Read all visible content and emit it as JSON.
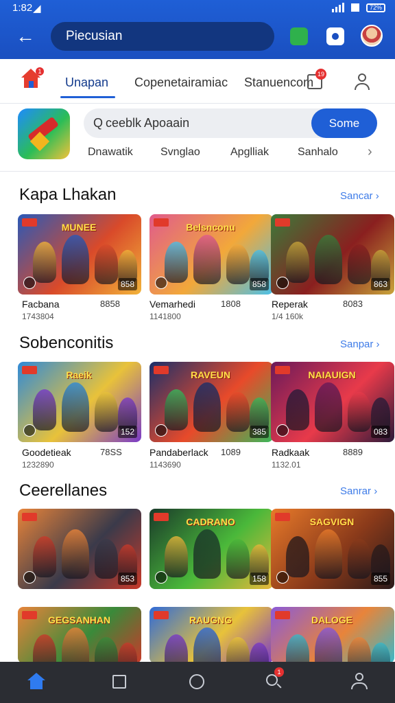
{
  "status_bar": {
    "time": "1:82",
    "battery": "72%"
  },
  "app_bar": {
    "search_title": "Piecusian"
  },
  "tabs": {
    "home_badge": "1",
    "items": [
      {
        "label": "Unapan",
        "active": true
      },
      {
        "label": "Copenetairamiac",
        "active": false
      },
      {
        "label": "Stanuencom",
        "active": false
      }
    ],
    "calendar_badge": "19"
  },
  "search": {
    "icon": "Q",
    "text": "ceeblk Apoaain",
    "button": "Some"
  },
  "chips": [
    "Dnawatik",
    "Svnglao",
    "Apglliak",
    "Sanhalo"
  ],
  "sections": [
    {
      "title": "Kapa Lhakan",
      "see_all": "Sancar",
      "cards": [
        {
          "banner": "MUNEE",
          "price": "858",
          "name": "Facbana",
          "value": "8858",
          "sub": "1743804",
          "colors": [
            "#2a59b8",
            "#d94a2a",
            "#f2b33a"
          ]
        },
        {
          "banner": "Belsnconu",
          "price": "858",
          "name": "Vemarhedi",
          "value": "1808",
          "sub": "1141800",
          "colors": [
            "#e05b8c",
            "#f2a83a",
            "#4bc0e8"
          ]
        },
        {
          "banner": "",
          "price": "863",
          "name": "Reperak",
          "value": "8083",
          "sub": "1/4 160k",
          "colors": [
            "#3c7a3a",
            "#8a1f1f",
            "#c8a43a"
          ]
        }
      ]
    },
    {
      "title": "Sobenconitis",
      "see_all": "Sanpar",
      "cards": [
        {
          "banner": "Raeik",
          "price": "152",
          "name": "Goodetieak",
          "value": "78SS",
          "sub": "1232890",
          "colors": [
            "#2f8ad8",
            "#e8c23a",
            "#7a3ac8"
          ]
        },
        {
          "banner": "RAVEUN",
          "price": "385",
          "name": "Pandaberlack",
          "value": "1089",
          "sub": "1143690",
          "colors": [
            "#1a2f6a",
            "#e84a2a",
            "#3ab85a"
          ]
        },
        {
          "banner": "NAIAUIGN",
          "price": "083",
          "name": "Radkaak",
          "value": "8889",
          "sub": "1132.01",
          "colors": [
            "#6a1a5a",
            "#e83a4a",
            "#2a1a3a"
          ]
        }
      ]
    },
    {
      "title": "Ceerellanes",
      "see_all": "Sanrar",
      "cards": [
        {
          "banner": "",
          "price": "853",
          "name": "",
          "value": "",
          "sub": "",
          "colors": [
            "#e8843a",
            "#3a3a4a",
            "#c83a2a"
          ]
        },
        {
          "banner": "CADRANO",
          "price": "158",
          "name": "",
          "value": "",
          "sub": "",
          "colors": [
            "#1a3a2a",
            "#4ab83a",
            "#e8b83a"
          ]
        },
        {
          "banner": "SAGVIGN",
          "price": "855",
          "name": "",
          "value": "",
          "sub": "",
          "colors": [
            "#e87a2a",
            "#8a3a1a",
            "#2a1a1a"
          ]
        }
      ]
    },
    {
      "title": "",
      "see_all": "",
      "cards": [
        {
          "banner": "GEGSANHAN",
          "price": "",
          "name": "",
          "value": "",
          "sub": "",
          "colors": [
            "#e8843a",
            "#3a8a3a",
            "#c83a2a"
          ]
        },
        {
          "banner": "RAUGNG",
          "price": "",
          "name": "",
          "value": "",
          "sub": "",
          "colors": [
            "#2f6ad8",
            "#e8c23a",
            "#7a3ac8"
          ]
        },
        {
          "banner": "DALOGE",
          "price": "",
          "name": "",
          "value": "",
          "sub": "",
          "colors": [
            "#8a5ad8",
            "#e8843a",
            "#3ab8c8"
          ]
        }
      ]
    }
  ],
  "bottom_nav": {
    "items": [
      "home-icon",
      "square-icon",
      "circle-icon",
      "search-icon",
      "user-icon"
    ],
    "search_badge": "1"
  }
}
